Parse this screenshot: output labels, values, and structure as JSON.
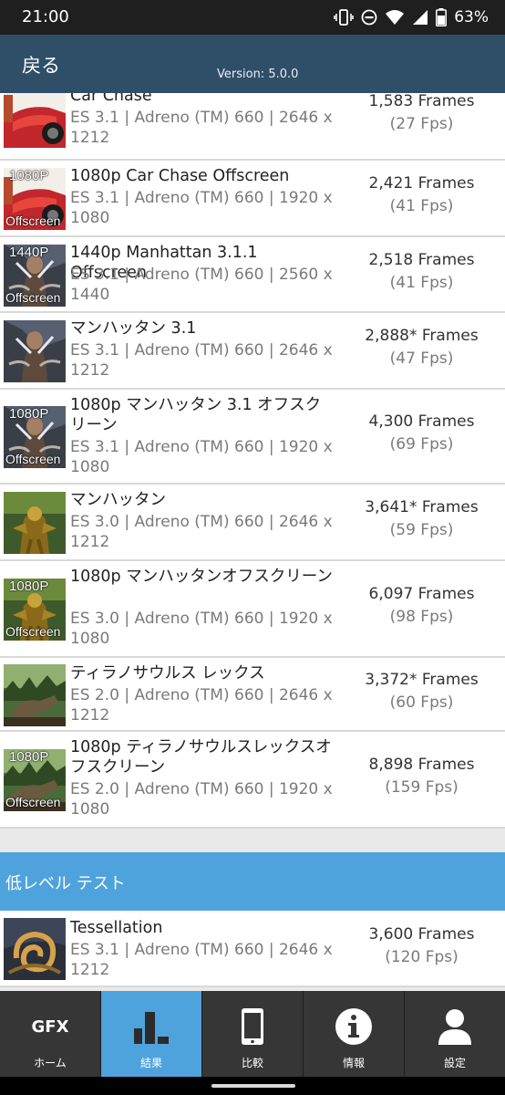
{
  "status_bar": {
    "time": "21:00",
    "battery": "63%",
    "icons": [
      "vibrate-icon",
      "dnd-icon",
      "wifi-icon",
      "signal-icon",
      "battery-icon"
    ]
  },
  "header": {
    "back_label": "戻る",
    "version": "Version: 5.0.0"
  },
  "results": [
    {
      "title": "Car Chase",
      "spec": "ES 3.1 | Adreno (TM) 660 | 2646 x 1212",
      "frames": "1,583 Frames",
      "fps": "(27 Fps)",
      "badge_top": "",
      "badge_bottom": "",
      "thumb": "car-chase"
    },
    {
      "title": "1080p Car Chase Offscreen",
      "spec": "ES 3.1 | Adreno (TM) 660 | 1920 x 1080",
      "frames": "2,421 Frames",
      "fps": "(41 Fps)",
      "badge_top": "1080P",
      "badge_bottom": "Offscreen",
      "thumb": "car-chase"
    },
    {
      "title": "1440p Manhattan 3.1.1 Offscreen",
      "spec": "ES 3.1 | Adreno (TM) 660 | 2560 x 1440",
      "frames": "2,518 Frames",
      "fps": "(41 Fps)",
      "badge_top": "1440P",
      "badge_bottom": "Offscreen",
      "thumb": "manhattan31"
    },
    {
      "title": "マンハッタン 3.1",
      "spec": "ES 3.1 | Adreno (TM) 660 | 2646 x 1212",
      "frames": "2,888* Frames",
      "fps": "(47 Fps)",
      "badge_top": "",
      "badge_bottom": "",
      "thumb": "manhattan31"
    },
    {
      "title": "1080p マンハッタン 3.1 オフスクリーン",
      "spec": "ES 3.1 | Adreno (TM) 660 | 1920 x 1080",
      "frames": "4,300 Frames",
      "fps": "(69 Fps)",
      "badge_top": "1080P",
      "badge_bottom": "Offscreen",
      "thumb": "manhattan31"
    },
    {
      "title": "マンハッタン",
      "spec": "ES 3.0 | Adreno (TM) 660 | 2646 x 1212",
      "frames": "3,641* Frames",
      "fps": "(59 Fps)",
      "badge_top": "",
      "badge_bottom": "",
      "thumb": "manhattan"
    },
    {
      "title": "1080p マンハッタンオフスクリーン",
      "spec": "ES 3.0 | Adreno (TM) 660 | 1920 x 1080",
      "frames": "6,097 Frames",
      "fps": "(98 Fps)",
      "badge_top": "1080P",
      "badge_bottom": "Offscreen",
      "thumb": "manhattan"
    },
    {
      "title": "ティラノサウルス レックス",
      "spec": "ES 2.0 | Adreno (TM) 660 | 2646 x 1212",
      "frames": "3,372* Frames",
      "fps": "(60 Fps)",
      "badge_top": "",
      "badge_bottom": "",
      "thumb": "trex"
    },
    {
      "title": "1080p ティラノサウルスレックスオフスクリーン",
      "spec": "ES 2.0 | Adreno (TM) 660 | 1920 x 1080",
      "frames": "8,898 Frames",
      "fps": "(159 Fps)",
      "badge_top": "1080P",
      "badge_bottom": "Offscreen",
      "thumb": "trex"
    }
  ],
  "low_level_section": {
    "title": "低レベル テスト",
    "items": [
      {
        "title": "Tessellation",
        "spec": "ES 3.1 | Adreno (TM) 660 | 2646 x 1212",
        "frames": "3,600 Frames",
        "fps": "(120 Fps)",
        "badge_top": "",
        "badge_bottom": "",
        "thumb": "tessellation"
      }
    ]
  },
  "bottom_nav": {
    "items": [
      {
        "label": "ホーム",
        "icon": "gfx-home-icon",
        "icon_text": "GFX",
        "active": false
      },
      {
        "label": "結果",
        "icon": "bar-chart-icon",
        "active": true
      },
      {
        "label": "比較",
        "icon": "phone-icon",
        "active": false
      },
      {
        "label": "情報",
        "icon": "info-icon",
        "active": false
      },
      {
        "label": "設定",
        "icon": "user-icon",
        "active": false
      }
    ]
  },
  "colors": {
    "header_bg": "#2f4f69",
    "accent": "#4fa3dd",
    "nav_bg": "#363636",
    "status_bg": "#1f1f1f"
  }
}
